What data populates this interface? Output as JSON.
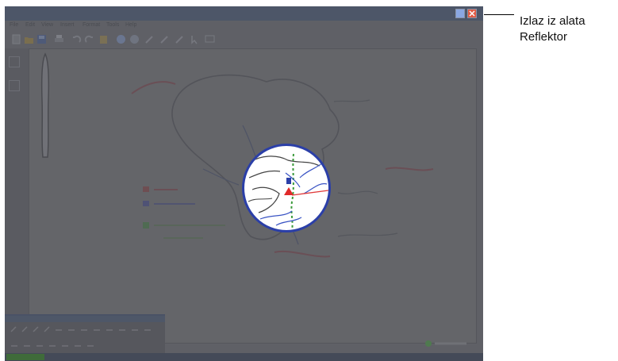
{
  "window": {
    "menu": [
      "File",
      "Edit",
      "View",
      "Insert",
      "Format",
      "Tools",
      "Help"
    ]
  },
  "toolbar": {
    "icons": [
      "new-icon",
      "open-icon",
      "save-icon",
      "print-icon",
      "undo-icon",
      "redo-icon",
      "paste-icon",
      "globe-icon",
      "zoom-icon",
      "pen-icon",
      "marker-icon",
      "highlighter-icon",
      "screen-icon"
    ]
  },
  "callout": {
    "line1": "Izlaz iz alata",
    "line2": "Reflektor"
  },
  "colors": {
    "spotlight_border": "#2b3fa8",
    "close_button": "#e05b45",
    "max_button": "#8aa7e3"
  }
}
